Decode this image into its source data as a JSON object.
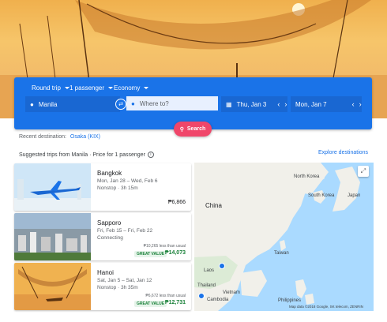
{
  "search": {
    "trip_type": "Round trip",
    "passengers": "1 passenger",
    "cabin": "Economy",
    "origin": "Manila",
    "destination_placeholder": "Where to?",
    "depart_date": "Thu, Jan 3",
    "return_date": "Mon, Jan 7",
    "search_label": "Search"
  },
  "recent": {
    "label": "Recent destination:",
    "destination": "Osaka (KIX)"
  },
  "suggestions": {
    "title": "Suggested trips from Manila · Price for 1 passenger",
    "explore_label": "Explore destinations",
    "trips": [
      {
        "city": "Bangkok",
        "dates": "Mon, Jan 28 – Wed, Feb 6",
        "stops": "Nonstop · 3h 15m",
        "price": "₱6,866"
      },
      {
        "city": "Sapporo",
        "dates": "Fri, Feb 15 – Fri, Feb 22",
        "stops": "Connecting",
        "less_than_usual": "₱10,265 less than usual",
        "badge": "GREAT VALUE",
        "price": "₱14,073"
      },
      {
        "city": "Hanoi",
        "dates": "Sat, Jan 5 – Sat, Jan 12",
        "stops": "Nonstop · 3h 35m",
        "less_than_usual": "₱6,672 less than usual",
        "badge": "GREAT VALUE",
        "price": "₱12,731"
      }
    ]
  },
  "map": {
    "labels": {
      "north_korea": "North Korea",
      "south_korea": "South Korea",
      "japan": "Japan",
      "china": "China",
      "taiwan": "Taiwan",
      "laos": "Laos",
      "thailand": "Thailand",
      "vietnam": "Vietnam",
      "cambodia": "Cambodia",
      "philippines": "Philippines"
    },
    "attribution": "Map data ©2018 Google, SK telecom, ZENRIN"
  },
  "colors": {
    "accent": "#1a73e8",
    "search_button": "#f0466a",
    "great_value": "#188038"
  }
}
